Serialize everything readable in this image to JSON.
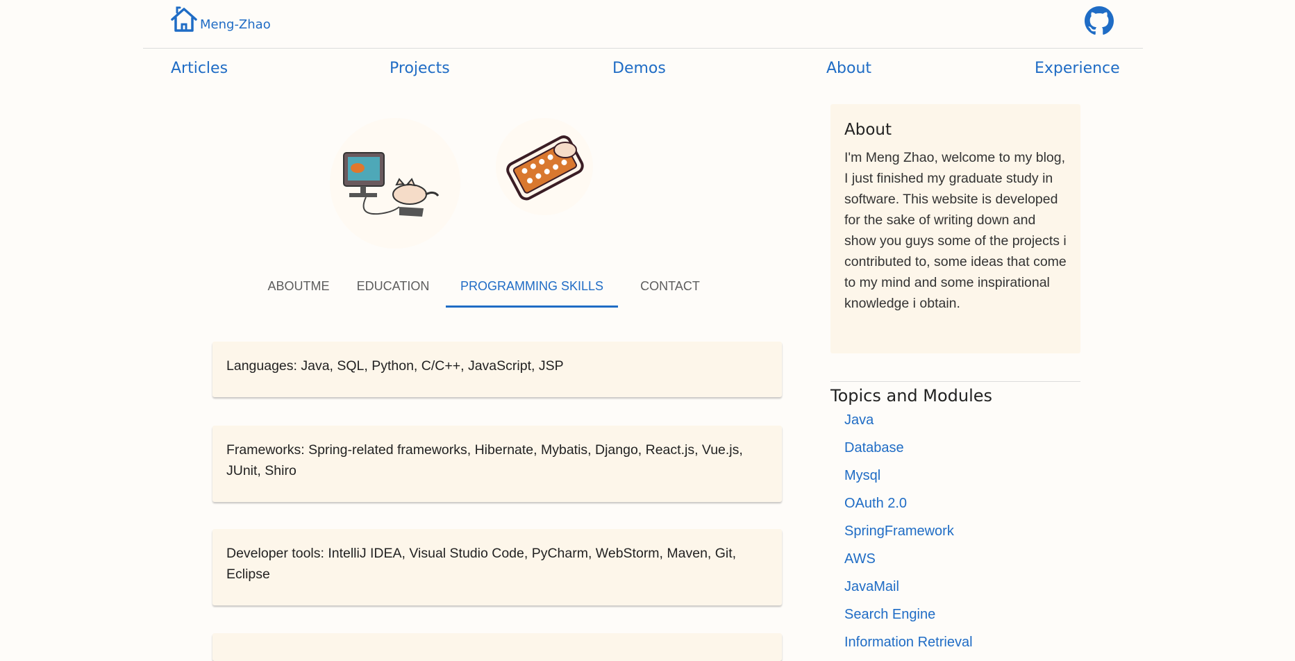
{
  "header": {
    "brand": "Meng-Zhao",
    "icons": {
      "home": "home-icon",
      "github": "github-icon"
    },
    "accent_color": "#1f6cc5"
  },
  "nav": [
    "Articles",
    "Projects",
    "Demos",
    "About",
    "Experience"
  ],
  "tabs": {
    "items": [
      "ABOUTME",
      "EDUCATION",
      "PROGRAMMING SKILLS",
      "CONTACT"
    ],
    "selected": "PROGRAMMING SKILLS"
  },
  "skills": [
    "Languages: Java, SQL, Python, C/C++, JavaScript, JSP",
    "Frameworks: Spring-related frameworks, Hibernate, Mybatis, Django, React.js, Vue.js, JUnit, Shiro",
    "Developer tools: IntelliJ IDEA, Visual Studio Code, PyCharm, WebStorm, Maven, Git, Eclipse",
    ""
  ],
  "sidebar": {
    "about_title": "About",
    "about_text": "I'm Meng Zhao, welcome to my blog, I just finished my graduate study in software. This website is developed for the sake of writing down and show you guys some of the projects i contributed to, some ideas that come to my mind and some inspirational knowledge i obtain.",
    "topics_title": "Topics and Modules",
    "topics": [
      "Java",
      "Database",
      "Mysql",
      "OAuth 2.0",
      "SpringFramework",
      "AWS",
      "JavaMail",
      "Search Engine",
      "Information Retrieval"
    ]
  }
}
